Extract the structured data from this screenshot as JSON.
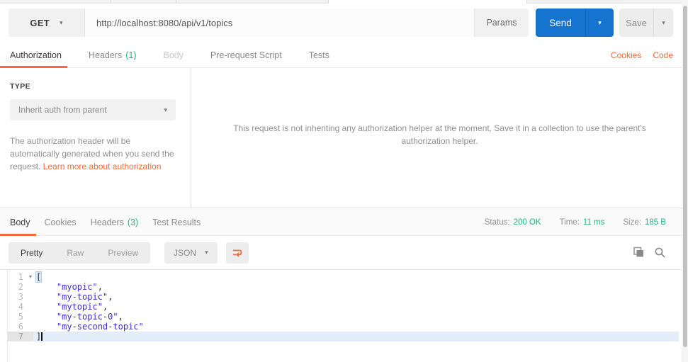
{
  "request": {
    "method": "GET",
    "url": "http://localhost:8080/api/v1/topics",
    "params_label": "Params",
    "send_label": "Send",
    "save_label": "Save"
  },
  "request_tabs": [
    {
      "label": "Authorization",
      "count": "",
      "active": true,
      "muted": false
    },
    {
      "label": "Headers",
      "count": "(1)",
      "active": false,
      "muted": false
    },
    {
      "label": "Body",
      "count": "",
      "active": false,
      "muted": true
    },
    {
      "label": "Pre-request Script",
      "count": "",
      "active": false,
      "muted": false
    },
    {
      "label": "Tests",
      "count": "",
      "active": false,
      "muted": false
    }
  ],
  "corner_links": {
    "cookies": "Cookies",
    "code": "Code"
  },
  "auth": {
    "type_label": "TYPE",
    "type_value": "Inherit auth from parent",
    "description": "The authorization header will be automatically generated when you send the request. ",
    "link_text": "Learn more about authorization",
    "message": "This request is not inheriting any authorization helper at the moment. Save it in a collection to use the parent's authorization helper."
  },
  "response": {
    "tabs": [
      {
        "label": "Body",
        "count": "",
        "active": true,
        "muted": false
      },
      {
        "label": "Cookies",
        "count": "",
        "active": false,
        "muted": false
      },
      {
        "label": "Headers",
        "count": "(3)",
        "active": false,
        "muted": false
      },
      {
        "label": "Test Results",
        "count": "",
        "active": false,
        "muted": false
      }
    ],
    "meta": [
      {
        "label": "Status:",
        "value": "200 OK"
      },
      {
        "label": "Time:",
        "value": "11 ms"
      },
      {
        "label": "Size:",
        "value": "185 B"
      }
    ],
    "view_modes": [
      {
        "label": "Pretty",
        "active": true
      },
      {
        "label": "Raw",
        "active": false
      },
      {
        "label": "Preview",
        "active": false
      }
    ],
    "format_value": "JSON"
  },
  "editor": {
    "lines": [
      {
        "num": "1",
        "fold": true,
        "active": false,
        "cursor": false,
        "parts": [
          {
            "t": "[",
            "c": "match"
          }
        ]
      },
      {
        "num": "2",
        "fold": false,
        "active": false,
        "cursor": false,
        "parts": [
          {
            "t": "    ",
            "c": "plain"
          },
          {
            "t": "\"myopic\"",
            "c": "string"
          },
          {
            "t": ",",
            "c": "plain"
          }
        ]
      },
      {
        "num": "3",
        "fold": false,
        "active": false,
        "cursor": false,
        "parts": [
          {
            "t": "    ",
            "c": "plain"
          },
          {
            "t": "\"my-topic\"",
            "c": "string"
          },
          {
            "t": ",",
            "c": "plain"
          }
        ]
      },
      {
        "num": "4",
        "fold": false,
        "active": false,
        "cursor": false,
        "parts": [
          {
            "t": "    ",
            "c": "plain"
          },
          {
            "t": "\"mytopic\"",
            "c": "string"
          },
          {
            "t": ",",
            "c": "plain"
          }
        ]
      },
      {
        "num": "5",
        "fold": false,
        "active": false,
        "cursor": false,
        "parts": [
          {
            "t": "    ",
            "c": "plain"
          },
          {
            "t": "\"my-topic-0\"",
            "c": "string"
          },
          {
            "t": ",",
            "c": "plain"
          }
        ]
      },
      {
        "num": "6",
        "fold": false,
        "active": false,
        "cursor": false,
        "parts": [
          {
            "t": "    ",
            "c": "plain"
          },
          {
            "t": "\"my-second-topic\"",
            "c": "string"
          }
        ]
      },
      {
        "num": "7",
        "fold": false,
        "active": true,
        "cursor": true,
        "parts": [
          {
            "t": "]",
            "c": "plain"
          }
        ]
      }
    ]
  },
  "colors": {
    "accent_orange": "#f26b3a",
    "send_blue": "#1674d1",
    "success_green": "#26b47f",
    "string_blue": "#3d2fc9"
  }
}
